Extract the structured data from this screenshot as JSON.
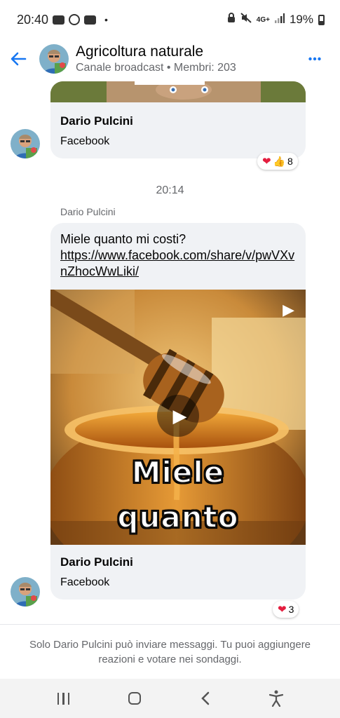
{
  "status_bar": {
    "time": "20:40",
    "dot": "•",
    "network": "4G+",
    "battery": "19%",
    "icons": [
      "youtube-icon",
      "yahoo-icon",
      "youtube-icon",
      "lock-icon",
      "mute-icon",
      "signal-icon",
      "battery-icon"
    ]
  },
  "header": {
    "title": "Agricoltura naturale",
    "subtitle": "Canale broadcast • Membri: 203",
    "back_icon": "←",
    "more_icon": "•••"
  },
  "messages": [
    {
      "link_preview": {
        "title": "Dario Pulcini",
        "source": "Facebook"
      },
      "reactions": {
        "emoji": [
          "❤",
          "👍"
        ],
        "count": "8"
      }
    }
  ],
  "divider_time": "20:14",
  "sender_name": "Dario Pulcini",
  "message2": {
    "text": "Miele quanto mi costi?",
    "link": "https://www.facebook.com/share/v/pwVXvnZhocWwLiki/",
    "video_overlay_line1": "Miele",
    "video_overlay_line2": "quanto",
    "link_preview": {
      "title": "Dario Pulcini",
      "source": "Facebook"
    },
    "reactions": {
      "emoji": [
        "❤"
      ],
      "count": "3"
    }
  },
  "footer_note": "Solo Dario Pulcini può inviare messaggi. Tu puoi aggiungere reazioni e votare nei sondaggi.",
  "colors": {
    "accent": "#1877f2",
    "bubble": "#f0f2f5",
    "secondary_text": "#65676b",
    "heart": "#e41e3f"
  }
}
